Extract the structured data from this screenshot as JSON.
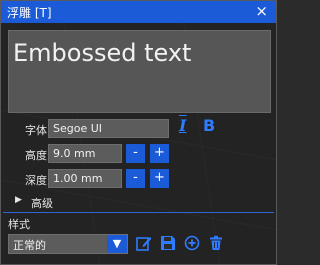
{
  "window": {
    "title": "浮雕 [T]",
    "close_glyph": "×"
  },
  "text_input": {
    "value": "Embossed text"
  },
  "font_row": {
    "label": "字体",
    "value": "Segoe UI",
    "italic_glyph": "I",
    "bold_glyph": "B"
  },
  "height_row": {
    "label": "高度",
    "value": "9.0 mm",
    "minus": "-",
    "plus": "+"
  },
  "depth_row": {
    "label": "深度",
    "value": "1.00 mm",
    "minus": "-",
    "plus": "+"
  },
  "advanced": {
    "arrow": "▶",
    "label": "高级"
  },
  "style_section": {
    "label": "样式",
    "selected": "正常的",
    "dropdown_arrow": "▼"
  },
  "colors": {
    "accent": "#1c5bd8",
    "icon_blue": "#2f7bff"
  },
  "icons": {
    "italic": "italic-icon",
    "bold": "bold-icon",
    "edit": "edit-icon",
    "save": "save-icon",
    "add": "add-icon",
    "delete": "trash-icon"
  }
}
